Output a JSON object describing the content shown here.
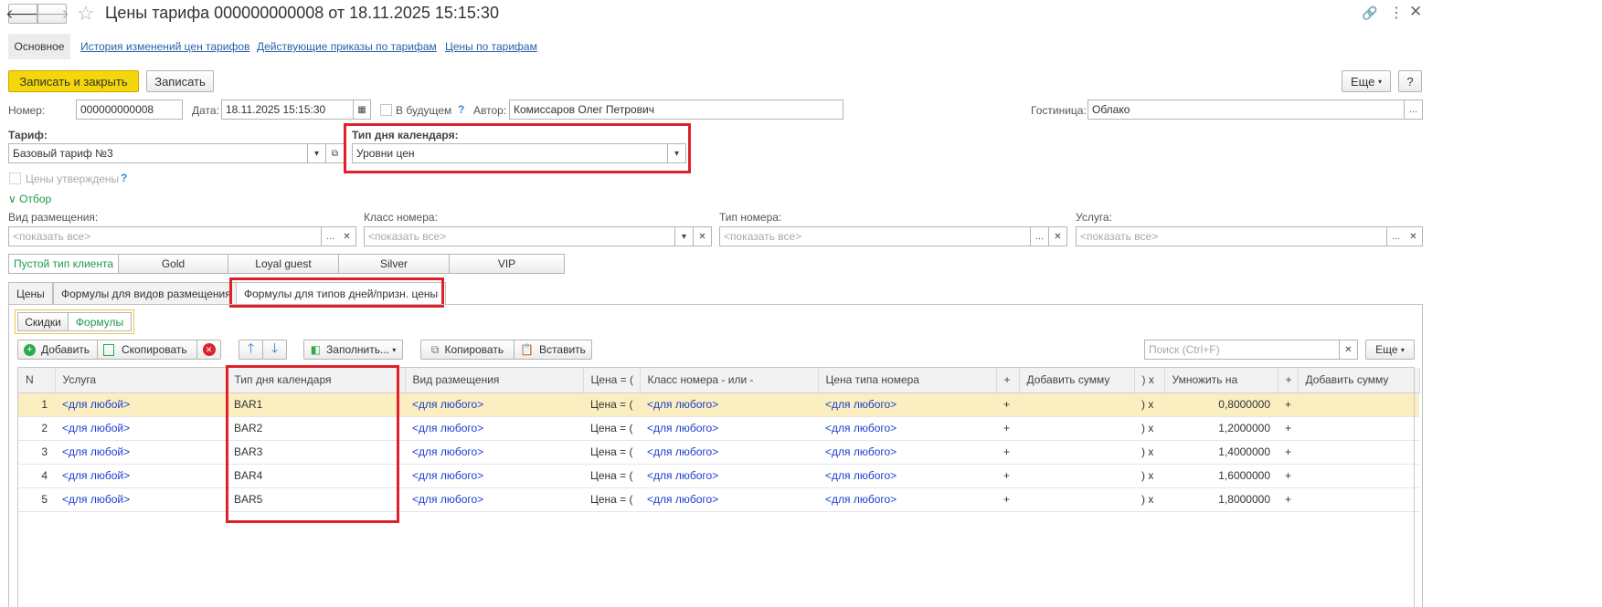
{
  "title": "Цены тарифа 000000000008 от 18.11.2025 15:15:30",
  "nav": {
    "main_tab": "Основное",
    "links": [
      "История изменений цен тарифов",
      "Действующие приказы по тарифам",
      "Цены по тарифам"
    ]
  },
  "toolbar": {
    "save_close": "Записать и закрыть",
    "save": "Записать",
    "more": "Еще",
    "help": "?"
  },
  "header": {
    "number_label": "Номер:",
    "number_value": "000000000008",
    "date_label": "Дата:",
    "date_value": "18.11.2025 15:15:30",
    "future_label": "В будущем",
    "author_label": "Автор:",
    "author_value": "Комиссаров Олег Петрович",
    "hotel_label": "Гостиница:",
    "hotel_value": "Облако",
    "tariff_label": "Тариф:",
    "tariff_value": "Базовый тариф №3",
    "day_type_label": "Тип дня календаря:",
    "day_type_value": "Уровни цен",
    "approved_label": "Цены утверждены"
  },
  "filter": {
    "title": "Отбор",
    "placeholder": "<показать все>",
    "fields": [
      "Вид размещения:",
      "Класс номера:",
      "Тип номера:",
      "Услуга:"
    ]
  },
  "client_types": [
    "Пустой тип клиента",
    "Gold",
    "Loyal guest",
    "Silver",
    "VIP"
  ],
  "tabs": [
    "Цены",
    "Формулы для видов размещения",
    "Формулы для типов дней/призн. цены"
  ],
  "subtabs": [
    "Скидки",
    "Формулы"
  ],
  "table_toolbar": {
    "add": "Добавить",
    "copy_row": "Скопировать",
    "fill": "Заполнить...",
    "copy": "Копировать",
    "paste": "Вставить",
    "search_placeholder": "Поиск (Ctrl+F)",
    "more": "Еще"
  },
  "columns": [
    "N",
    "Услуга",
    "Тип дня календаря",
    "Вид размещения",
    "Цена = (",
    "Класс номера - или -",
    "Цена типа номера",
    "+",
    "Добавить сумму",
    ") x",
    "Умножить на",
    "+",
    "Добавить сумму"
  ],
  "rows": [
    {
      "n": "1",
      "service": "<для любой>",
      "day_type": "BAR1",
      "placement": "<для любого>",
      "price": "Цена = (",
      "room_class": "<для любого>",
      "room_type_price": "<для любого>",
      "plus": "+",
      "add": "",
      "close": ") x",
      "mult": "0,8000000",
      "plus2": "+",
      "add2": ""
    },
    {
      "n": "2",
      "service": "<для любой>",
      "day_type": "BAR2",
      "placement": "<для любого>",
      "price": "Цена = (",
      "room_class": "<для любого>",
      "room_type_price": "<для любого>",
      "plus": "+",
      "add": "",
      "close": ") x",
      "mult": "1,2000000",
      "plus2": "+",
      "add2": ""
    },
    {
      "n": "3",
      "service": "<для любой>",
      "day_type": "BAR3",
      "placement": "<для любого>",
      "price": "Цена = (",
      "room_class": "<для любого>",
      "room_type_price": "<для любого>",
      "plus": "+",
      "add": "",
      "close": ") x",
      "mult": "1,4000000",
      "plus2": "+",
      "add2": ""
    },
    {
      "n": "4",
      "service": "<для любой>",
      "day_type": "BAR4",
      "placement": "<для любого>",
      "price": "Цена = (",
      "room_class": "<для любого>",
      "room_type_price": "<для любого>",
      "plus": "+",
      "add": "",
      "close": ") x",
      "mult": "1,6000000",
      "plus2": "+",
      "add2": ""
    },
    {
      "n": "5",
      "service": "<для любой>",
      "day_type": "BAR5",
      "placement": "<для любого>",
      "price": "Цена = (",
      "room_class": "<для любого>",
      "room_type_price": "<для любого>",
      "plus": "+",
      "add": "",
      "close": ") x",
      "mult": "1,8000000",
      "plus2": "+",
      "add2": ""
    }
  ],
  "colors": {
    "accent_yellow": "#f5d60a",
    "highlight": "#e0202a",
    "link": "#2a5fa8",
    "green": "#1f9a4a",
    "row_selected": "#fbeec0"
  }
}
